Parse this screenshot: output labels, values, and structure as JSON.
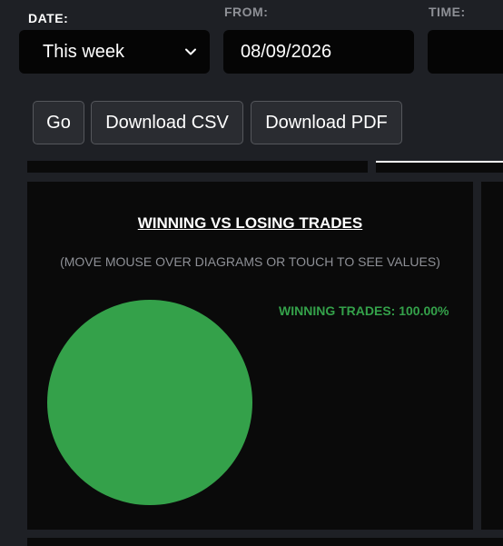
{
  "filters": {
    "date_label": "DATE:",
    "date_value": "This week",
    "from_label": "FROM:",
    "from_value": "08/09/2026",
    "time_label": "TIME:",
    "time_value": ""
  },
  "actions": {
    "go_label": "Go",
    "csv_label": "Download CSV",
    "pdf_label": "Download PDF"
  },
  "card": {
    "title": "WINNING VS LOSING TRADES",
    "hint": "(MOVE MOUSE OVER DIAGRAMS OR TOUCH TO SEE VALUES)",
    "legend_winning": "WINNING TRADES: 100.00%"
  },
  "colors": {
    "win": "#34a14a",
    "background": "#1e2025",
    "panel": "#0a0a0a"
  },
  "chart_data": {
    "type": "pie",
    "title": "WINNING VS LOSING TRADES",
    "slices": [
      {
        "label": "WINNING TRADES",
        "value": 100.0,
        "color": "#34a14a"
      }
    ]
  }
}
